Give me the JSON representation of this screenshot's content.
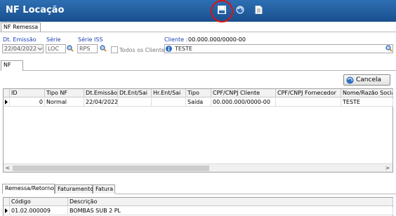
{
  "window": {
    "title": "NF Locação"
  },
  "toolbar": {
    "icons": [
      "save-icon",
      "undo-icon",
      "document-icon"
    ]
  },
  "top_tab": {
    "label": "NF Remessa"
  },
  "form": {
    "dt_emissao": {
      "label": "Dt. Emissão",
      "value": "22/04/2022"
    },
    "serie": {
      "label": "Série",
      "value": "LOC"
    },
    "serie_iss": {
      "label": "Série ISS",
      "value": "RPS"
    },
    "todos_clientes": {
      "label": "Todos os Clientes",
      "checked": false
    },
    "cliente": {
      "label": "Cliente :",
      "cnpj": "00.000.000/0000-00",
      "value": "TESTE"
    }
  },
  "inner_tab": {
    "label": "NF"
  },
  "cancel_button": {
    "label": "Cancela"
  },
  "grid": {
    "columns": [
      "ID",
      "Tipo NF",
      "Dt.Emissão",
      "Dt.Ent/Sai",
      "Hr.Ent/Sai",
      "Tipo",
      "CPF/CNPJ Cliente",
      "CPF/CNPJ Fornecedor",
      "Nome/Razão Social"
    ],
    "rows": [
      {
        "id": "0",
        "tipo_nf": "Normal",
        "dt_emissao": "22/04/2022",
        "dt_ent_sai": "",
        "hr_ent_sai": "",
        "tipo": "Saída",
        "cpf_cnpj_cliente": "00.000.000/0000-00",
        "cpf_cnpj_fornecedor": "",
        "nome": "TESTE"
      }
    ]
  },
  "bottom_tabs": [
    "Remessa/Retorno",
    "Faturamento",
    "Fatura"
  ],
  "bottom_grid": {
    "columns": [
      "Código",
      "Descrição"
    ],
    "rows": [
      {
        "codigo": "01.02.000009",
        "descricao": "BOMBAS SUB 2 PL"
      }
    ]
  },
  "colors": {
    "titlebar": "#1f5c9e",
    "label": "#1a3fb0",
    "highlight": "#e01010"
  }
}
